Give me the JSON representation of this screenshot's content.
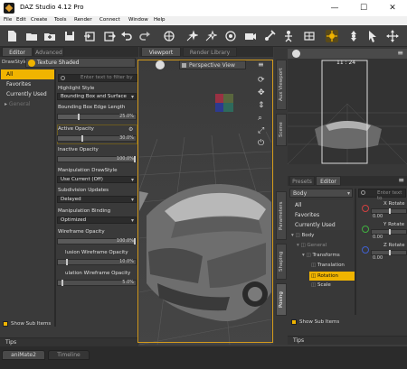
{
  "window": {
    "title": "DAZ Studio 4.12 Pro",
    "minimize": "—",
    "maximize": "☐",
    "close": "✕"
  },
  "menu": [
    "File",
    "Edit",
    "Create",
    "Tools",
    "Render",
    "Connect",
    "Window",
    "Help"
  ],
  "left": {
    "tabs": [
      "Editor",
      "Advanced"
    ],
    "drawstyle_label": "DrawStyle",
    "drawstyle_value": "Texture Shaded",
    "filter_placeholder": "Enter text to filter by",
    "categories": [
      "All",
      "Favorites",
      "Currently Used"
    ],
    "tree_item": "General",
    "props": {
      "highlight_style_label": "Highlight Style",
      "highlight_style_value": "Bounding Box and Surface",
      "bbox_edge_label": "Bounding Box Edge Length",
      "bbox_edge_value": "25.0%",
      "active_opacity_label": "Active Opacity",
      "active_opacity_value": "30.0%",
      "inactive_opacity_label": "Inactive Opacity",
      "inactive_opacity_value": "100.0%",
      "manip_drawstyle_label": "Manipulation DrawStyle",
      "manip_drawstyle_value": "Use Current (Off)",
      "subdiv_label": "Subdivision Updates",
      "subdiv_value": "Delayed",
      "manip_binding_label": "Manipulation Binding",
      "manip_binding_value": "Optimized",
      "wire_opacity_label": "Wireframe Opacity",
      "wire_opacity_value": "100.0%",
      "occl_wire_label": "lusion Wireframe Opacity",
      "occl_wire_value": "10.0%",
      "ulation_wire_label": "ulation Wireframe Opacity",
      "ulation_wire_value": "5.0%"
    },
    "show_sub_items": "Show Sub Items",
    "tips": "Tips"
  },
  "viewport": {
    "tabs": [
      "Viewport",
      "Render Library"
    ],
    "camera": "Perspective View"
  },
  "right": {
    "aux_ratio": "11 : 24",
    "side_tabs_top": [
      "Aux Viewport",
      "Scene"
    ],
    "tabs": [
      "Presets",
      "Editor"
    ],
    "node_select": "Body",
    "filter_placeholder": "Enter text to",
    "categories": [
      "All",
      "Favorites",
      "Currently Used"
    ],
    "tree": [
      "Body",
      "General",
      "Transforms",
      "Translation",
      "Rotation",
      "Scale"
    ],
    "params": [
      {
        "label": "X Rotate",
        "value": "0.00"
      },
      {
        "label": "Y Rotate",
        "value": "0.00"
      },
      {
        "label": "Z Rotate",
        "value": "0.00"
      }
    ],
    "side_tabs_bottom": [
      "Parameters",
      "Shaping",
      "Posing"
    ],
    "show_sub_items": "Show Sub Items",
    "tips": "Tips"
  },
  "bottom_tabs": [
    "aniMate2",
    "Timeline"
  ],
  "colors": {
    "accent": "#f0b400",
    "viewport_border": "#d39a1c"
  }
}
